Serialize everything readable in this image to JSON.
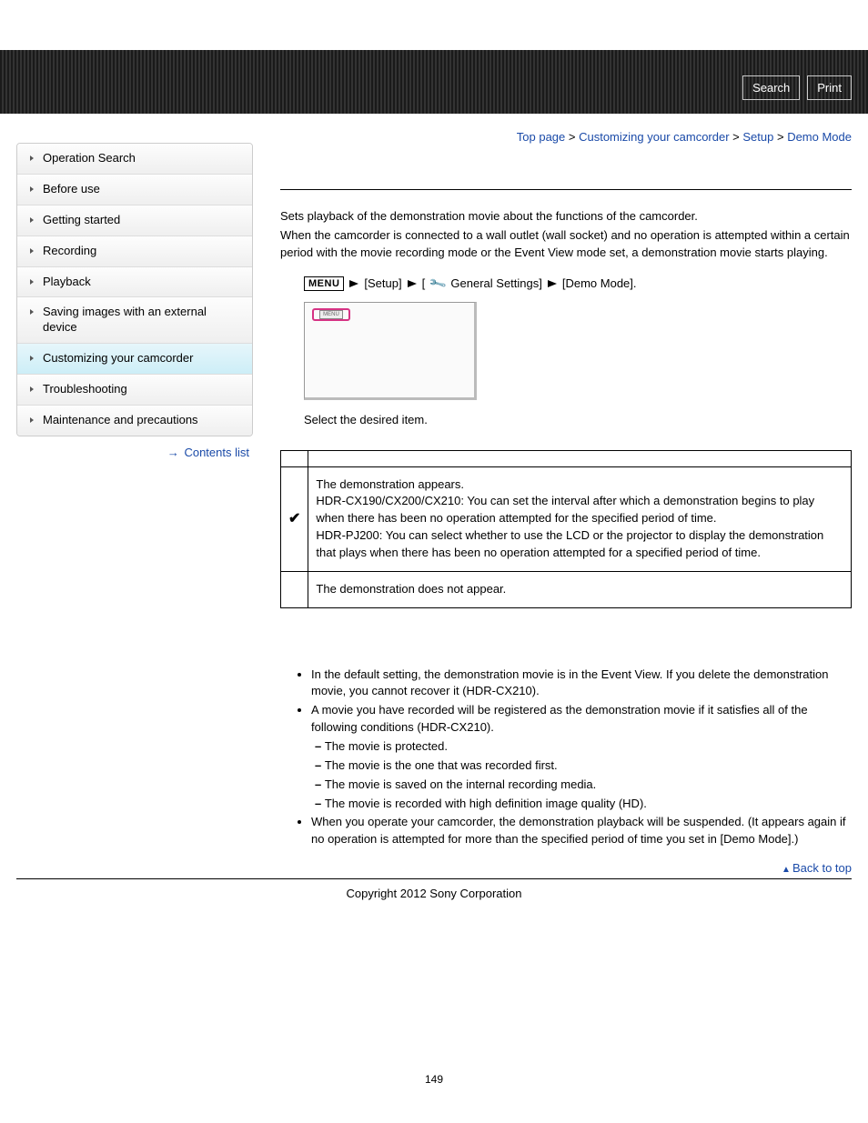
{
  "header": {
    "search_label": "Search",
    "print_label": "Print"
  },
  "breadcrumb": {
    "top_page": "Top page",
    "customizing": "Customizing your camcorder",
    "setup": "Setup",
    "current": "Demo Mode",
    "sep": " > "
  },
  "sidebar": {
    "items": [
      "Operation Search",
      "Before use",
      "Getting started",
      "Recording",
      "Playback",
      "Saving images with an external device",
      "Customizing your camcorder",
      "Troubleshooting",
      "Maintenance and precautions"
    ],
    "contents_list": "Contents list"
  },
  "content": {
    "intro_p1": "Sets playback of the demonstration movie about the functions of the camcorder.",
    "intro_p2": "When the camcorder is connected to a wall outlet (wall socket) and no operation is attempted within a certain period with the movie recording mode or the Event View mode set, a demonstration movie starts playing.",
    "path": {
      "menu_label": "MENU",
      "setup": "[Setup]",
      "general": "General Settings]",
      "general_prefix": "[",
      "demo": "[Demo Mode].",
      "menu_btn_inner": "MENU"
    },
    "select_text": "Select the desired item.",
    "table": {
      "row1_p1": "The demonstration appears.",
      "row1_p2": "HDR-CX190/CX200/CX210: You can set the interval after which a demonstration begins to play when there has been no operation attempted for the specified period of time.",
      "row1_p3": "HDR-PJ200: You can select whether to use the LCD or the projector to display the demonstration that plays when there has been no operation attempted for a specified period of time.",
      "row2": "The demonstration does not appear.",
      "check": "✔"
    },
    "notes": {
      "n1": "In the default setting, the demonstration movie is in the Event View. If you delete the demonstration movie, you cannot recover it (HDR-CX210).",
      "n2": "A movie you have recorded will be registered as the demonstration movie if it satisfies all of the following conditions (HDR-CX210).",
      "n2_sub": [
        "The movie is protected.",
        "The movie is the one that was recorded first.",
        "The movie is saved on the internal recording media.",
        "The movie is recorded with high definition image quality (HD)."
      ],
      "n3": "When you operate your camcorder, the demonstration playback will be suspended. (It appears again if no operation is attempted for more than the specified period of time you set in [Demo Mode].)"
    },
    "back_to_top": "Back to top"
  },
  "footer": {
    "copyright": "Copyright 2012 Sony Corporation",
    "page_number": "149"
  }
}
